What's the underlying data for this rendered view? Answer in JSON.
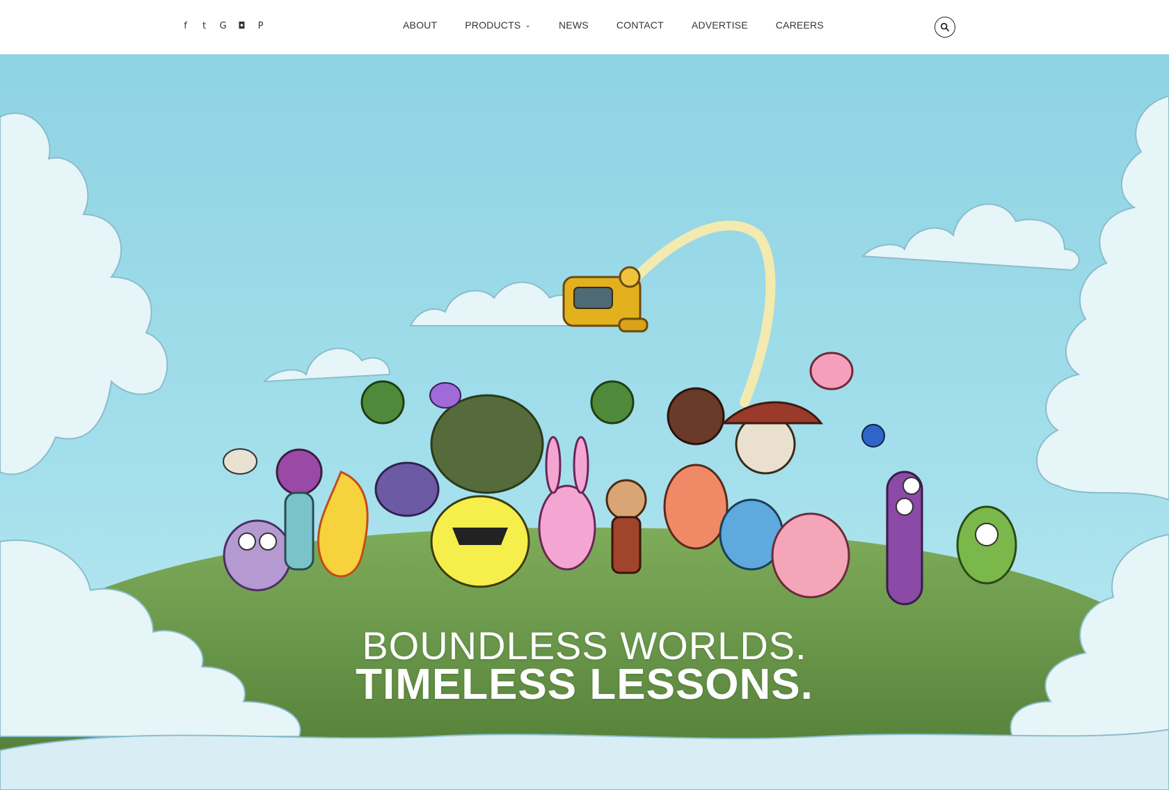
{
  "social": [
    {
      "icon": "facebook-icon",
      "glyph": "f"
    },
    {
      "icon": "twitter-icon",
      "glyph": "t"
    },
    {
      "icon": "google-icon",
      "glyph": "G"
    },
    {
      "icon": "instagram-icon",
      "glyph": "◘"
    },
    {
      "icon": "pinterest-icon",
      "glyph": "P"
    }
  ],
  "nav": {
    "about": "ABOUT",
    "products": "PRODUCTS",
    "news": "NEWS",
    "contact": "CONTACT",
    "advertise": "ADVERTISE",
    "careers": "CAREERS"
  },
  "hero": {
    "line1": "BOUNDLESS WORLDS.",
    "line2": "TIMELESS LESSONS."
  },
  "colors": {
    "sky": "#8fd3e3",
    "hill": "#6f9e4e",
    "cloud": "#e6f5f8",
    "text": "#333333"
  }
}
